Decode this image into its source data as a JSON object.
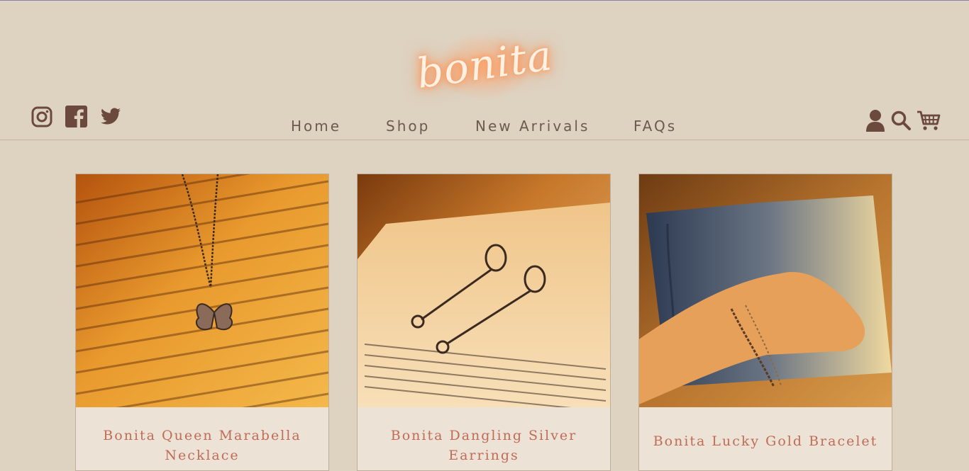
{
  "brand": {
    "logo_text": "bonita",
    "accent_color": "#c06c56",
    "glow_color": "#ff8a45"
  },
  "social": [
    {
      "name": "instagram-icon"
    },
    {
      "name": "facebook-icon"
    },
    {
      "name": "twitter-icon"
    }
  ],
  "nav": {
    "home": "Home",
    "shop": "Shop",
    "new_arrivals": "New Arrivals",
    "faqs": "FAQs"
  },
  "utility_icons": [
    "account-icon",
    "search-icon",
    "cart-icon"
  ],
  "products": [
    {
      "title": "Bonita Queen Marabella Necklace",
      "image": "butterfly-necklace-on-book"
    },
    {
      "title": "Bonita Dangling Silver Earrings",
      "image": "silver-earrings-on-book"
    },
    {
      "title": "Bonita Lucky Gold Bracelet",
      "image": "gold-bracelet-on-wrist"
    }
  ]
}
